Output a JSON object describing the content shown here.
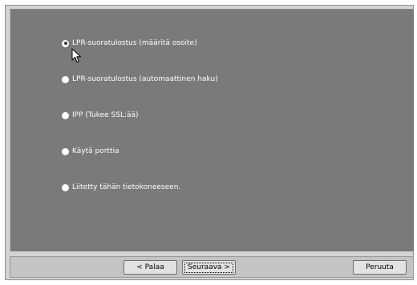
{
  "options": [
    {
      "label": "LPR-suoratulostus (määritä osoite)",
      "selected": true
    },
    {
      "label": "LPR-suoratulostus (automaattinen haku)",
      "selected": false
    },
    {
      "label": "IPP (Tukee SSL:ää)",
      "selected": false
    },
    {
      "label": "Käytä porttia",
      "selected": false
    },
    {
      "label": "Liitetty tähän tietokoneeseen.",
      "selected": false
    }
  ],
  "buttons": {
    "back": "< Palaa",
    "next": "Seuraava >",
    "cancel": "Peruuta"
  },
  "colors": {
    "panel": "#7a7a7a",
    "frame": "#d4d4d4",
    "label": "#ffffff"
  },
  "icons": {
    "cursor": "arrow-cursor-icon"
  }
}
